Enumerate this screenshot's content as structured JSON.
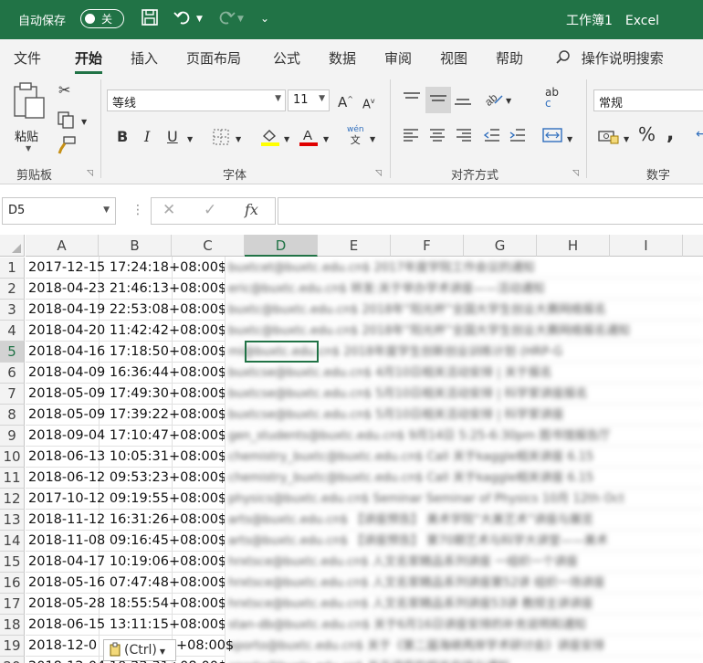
{
  "titlebar": {
    "autosave_label": "自动保存",
    "autosave_state": "关",
    "workbook": "工作簿1",
    "app": "Excel",
    "qa_more": "⌄"
  },
  "tabs": [
    "文件",
    "开始",
    "插入",
    "页面布局",
    "公式",
    "数据",
    "审阅",
    "视图",
    "帮助"
  ],
  "search_label": "操作说明搜索",
  "ribbon": {
    "clipboard": {
      "paste_label": "粘贴",
      "group_label": "剪贴板"
    },
    "font": {
      "font_name": "等线",
      "font_size": "11",
      "group_label": "字体",
      "phonetic_top": "wén",
      "phonetic_bottom": "文"
    },
    "alignment": {
      "group_label": "对齐方式",
      "wrap_top": "ab",
      "wrap_bottom": "c"
    },
    "number": {
      "format": "常规",
      "group_label": "数字"
    }
  },
  "formula_bar": {
    "name_box": "D5",
    "fx": "fx",
    "formula": ""
  },
  "columns": [
    "A",
    "B",
    "C",
    "D",
    "E",
    "F",
    "G",
    "H",
    "I"
  ],
  "selected_column": "D",
  "selected_row": "5",
  "rows": [
    {
      "n": "1",
      "a": "2017-12-15 17:24:18+08:00$",
      "d": "buxtcet@buxtc.edu.cn$ 2017年度学院工作会议的通知"
    },
    {
      "n": "2",
      "a": "2018-04-23 21:46:13+08:00$",
      "d": "eric@buxtc.edu.cn$ 转发:关于举办学术讲座——活动通知"
    },
    {
      "n": "3",
      "a": "2018-04-19 22:53:08+08:00$",
      "d": "buxtc@buxtc.edu.cn$ 2018年“阳光杯”全国大学生创业大赛网络报名"
    },
    {
      "n": "4",
      "a": "2018-04-20 11:42:42+08:00$",
      "d": "buxtc@buxtc.edu.cn$ 2018年“阳光杯”全国大学生创业大赛网络报名通知"
    },
    {
      "n": "5",
      "a": "2018-04-16 17:18:50+08:00$",
      "d": "mi@buxtc.edu.cn$ 2018年度学生创新创业训练计划 (HRP-G"
    },
    {
      "n": "6",
      "a": "2018-04-09 16:36:44+08:00$",
      "d": "buxtcse@buxtc.edu.cn$ 4月10日相关活动安排 | 关于报名"
    },
    {
      "n": "7",
      "a": "2018-05-09 17:49:30+08:00$",
      "d": "buxtcse@buxtc.edu.cn$ 5月10日相关活动安排 | 科学家讲座报名"
    },
    {
      "n": "8",
      "a": "2018-05-09 17:39:22+08:00$",
      "d": "buxtcse@buxtc.edu.cn$ 5月10日相关活动安排 | 科学家讲座"
    },
    {
      "n": "9",
      "a": "2018-09-04 17:10:47+08:00$",
      "d": "gen_students@buxtc.edu.cn$ 9月14日 5:25-6:30pm 图书馆报告厅"
    },
    {
      "n": "10",
      "a": "2018-06-13 10:05:31+08:00$",
      "d": "chemistry_buxtc@buxtc.edu.cn$ Call 关于kaggle相关讲座 6.15"
    },
    {
      "n": "11",
      "a": "2018-06-12 09:53:23+08:00$",
      "d": "chemistry_buxtc@buxtc.edu.cn$ Call 关于kaggle相关讲座 6.15"
    },
    {
      "n": "12",
      "a": "2017-10-12 09:19:55+08:00$",
      "d": "physics@buxtc.edu.cn$ Seminar Seminar of Physics 10月 12th Oct"
    },
    {
      "n": "13",
      "a": "2018-11-12 16:31:26+08:00$",
      "d": "arts@buxtc.edu.cn$ 【讲座预告】 美术学院“大美艺术”讲座与展览"
    },
    {
      "n": "14",
      "a": "2018-11-08 09:16:45+08:00$",
      "d": "arts@buxtc.edu.cn$ 【讲座预告】 第70期艺术与科学大讲堂——美术"
    },
    {
      "n": "15",
      "a": "2018-04-17 10:19:06+08:00$",
      "d": "hrxtsce@buxtc.edu.cn$ 人文名家精品系列讲座 一组织一个讲座"
    },
    {
      "n": "16",
      "a": "2018-05-16 07:47:48+08:00$",
      "d": "hrxtsce@buxtc.edu.cn$ 人文名家精品系列讲座第52讲 组织一场讲座"
    },
    {
      "n": "17",
      "a": "2018-05-28 18:55:54+08:00$",
      "d": "hrxtsce@buxtc.edu.cn$ 人文名家精品系列讲座53讲 教授主讲讲座"
    },
    {
      "n": "18",
      "a": "2018-06-15 13:11:15+08:00$",
      "d": "stan-db@buxtc.edu.cn$ 关于6月16日讲座安排的补充说明和通知"
    },
    {
      "n": "19",
      "a": "2018-12-0",
      "d": "xporto@buxtc.edu.cn$ 关于《第二届海峡两岸学术研讨会》讲座安排"
    },
    {
      "n": "20",
      "a": "2018-12-04 10:22:31+08:00$",
      "d": "xporto@buxtc.edu.cn$ 关于讲座的相关安排与通知"
    }
  ],
  "row19_tail": "+08:00$",
  "paste_options": "(Ctrl)"
}
